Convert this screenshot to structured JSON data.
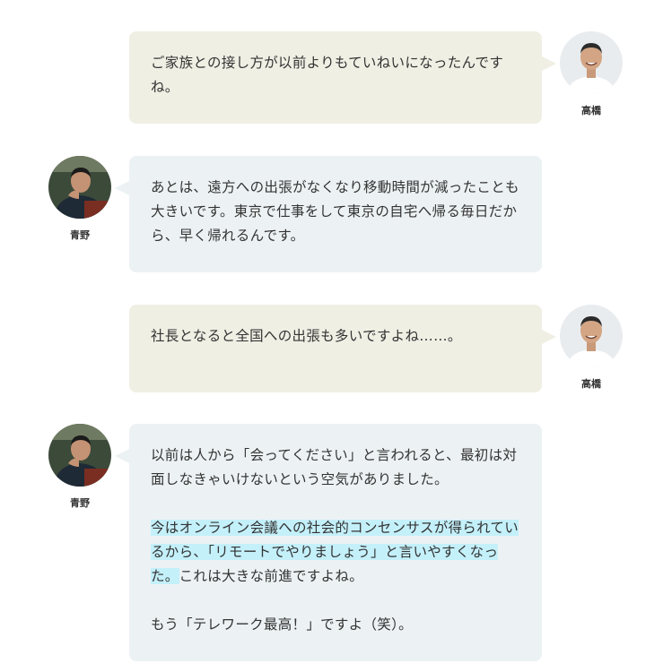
{
  "speakers": {
    "takahashi": {
      "name": "高橋",
      "avatar_icon": "person-avatar-icon"
    },
    "aono": {
      "name": "青野",
      "avatar_icon": "person-avatar-icon"
    }
  },
  "messages": [
    {
      "speaker": "高橋",
      "side": "right",
      "paragraphs": [
        "ご家族との接し方が以前よりもていねいになったんですね。"
      ]
    },
    {
      "speaker": "青野",
      "side": "left",
      "paragraphs": [
        "あとは、遠方への出張がなくなり移動時間が減ったことも大きいです。東京で仕事をして東京の自宅へ帰る毎日だから、早く帰れるんです。"
      ]
    },
    {
      "speaker": "高橋",
      "side": "right",
      "paragraphs": [
        "社長となると全国への出張も多いですよね……。"
      ]
    },
    {
      "speaker": "青野",
      "side": "left",
      "paragraphs": [
        "以前は人から「会ってください」と言われると、最初は対面しなきゃいけないという空気がありました。",
        {
          "highlighted": "今はオンライン会議への社会的コンセンサスが得られているから、「リモートでやりましょう」と言いやすくなった。",
          "rest": "これは大きな前進ですよね。"
        },
        "もう「テレワーク最高！」ですよ（笑）。"
      ]
    }
  ],
  "colors": {
    "bubble_right": "#f0efe4",
    "bubble_left": "#ecf2f4",
    "highlight": "#c4f0fa",
    "text": "#333333"
  }
}
